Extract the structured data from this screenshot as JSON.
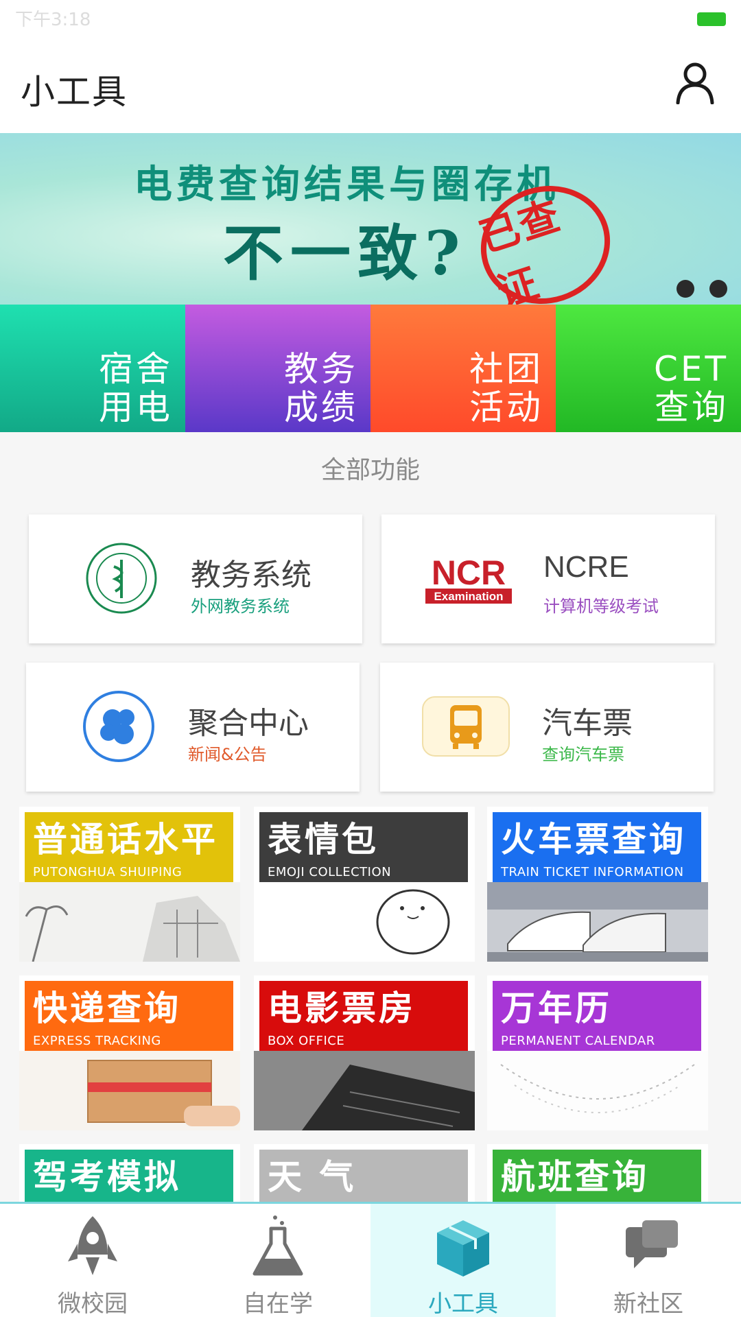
{
  "status_bar": {
    "time": "下午3:18"
  },
  "header": {
    "title": "小工具",
    "user_icon": "user-icon"
  },
  "banner": {
    "line1": "电费查询结果与圈存机",
    "line2": "不一致?",
    "stamp": "已查证",
    "dots": 2
  },
  "quick_tiles": [
    {
      "line1": "宿舍",
      "line2": "用电",
      "color": "#18c99b"
    },
    {
      "line1": "教务",
      "line2": "成绩",
      "color": "#8a4ad6"
    },
    {
      "line1": "社团",
      "line2": "活动",
      "color": "#ff5a30"
    },
    {
      "line1": "CET",
      "line2": "查询",
      "color": "#36d02f"
    }
  ],
  "section": {
    "title": "全部功能"
  },
  "cards": [
    {
      "name": "教务系统",
      "sub": "外网教务系统",
      "sub_color": "#1aa07e",
      "icon": "college-seal-icon"
    },
    {
      "name": "NCRE",
      "sub": "计算机等级考试",
      "sub_color": "#9a4fc0",
      "icon": "ncre-logo-icon",
      "logo_text": "NCR",
      "logo_sub": "Examination"
    },
    {
      "name": "聚合中心",
      "sub": "新闻&公告",
      "sub_color": "#e05a2b",
      "icon": "aggregate-center-icon"
    },
    {
      "name": "汽车票",
      "sub": "查询汽车票",
      "sub_color": "#3cb84a",
      "icon": "bus-icon"
    }
  ],
  "tiles": [
    {
      "cn": "普通话水平",
      "en": "PUTONGHUA SHUIPING CESHI",
      "color": "#e2c20a"
    },
    {
      "cn": "表情包",
      "en": "EMOJI COLLECTION",
      "color": "#3d3d3d"
    },
    {
      "cn": "火车票查询",
      "en": "TRAIN TICKET INFORMATION",
      "color": "#1a6ff0"
    },
    {
      "cn": "快递查询",
      "en": "EXPRESS TRACKING",
      "color": "#ff6a10"
    },
    {
      "cn": "电影票房",
      "en": "BOX OFFICE",
      "color": "#d80c0c"
    },
    {
      "cn": "万年历",
      "en": "PERMANENT CALENDAR",
      "color": "#a736d6"
    },
    {
      "cn": "驾考模拟",
      "en": "",
      "color": "#17b58a"
    },
    {
      "cn": "天 气",
      "en": "",
      "color": "#b8b8b8"
    },
    {
      "cn": "航班查询",
      "en": "",
      "color": "#38b33a"
    }
  ],
  "bottom_nav": [
    {
      "label": "微校园",
      "icon": "rocket-icon",
      "active": false
    },
    {
      "label": "自在学",
      "icon": "flask-icon",
      "active": false
    },
    {
      "label": "小工具",
      "icon": "box-icon",
      "active": true
    },
    {
      "label": "新社区",
      "icon": "chat-icon",
      "active": false
    }
  ]
}
